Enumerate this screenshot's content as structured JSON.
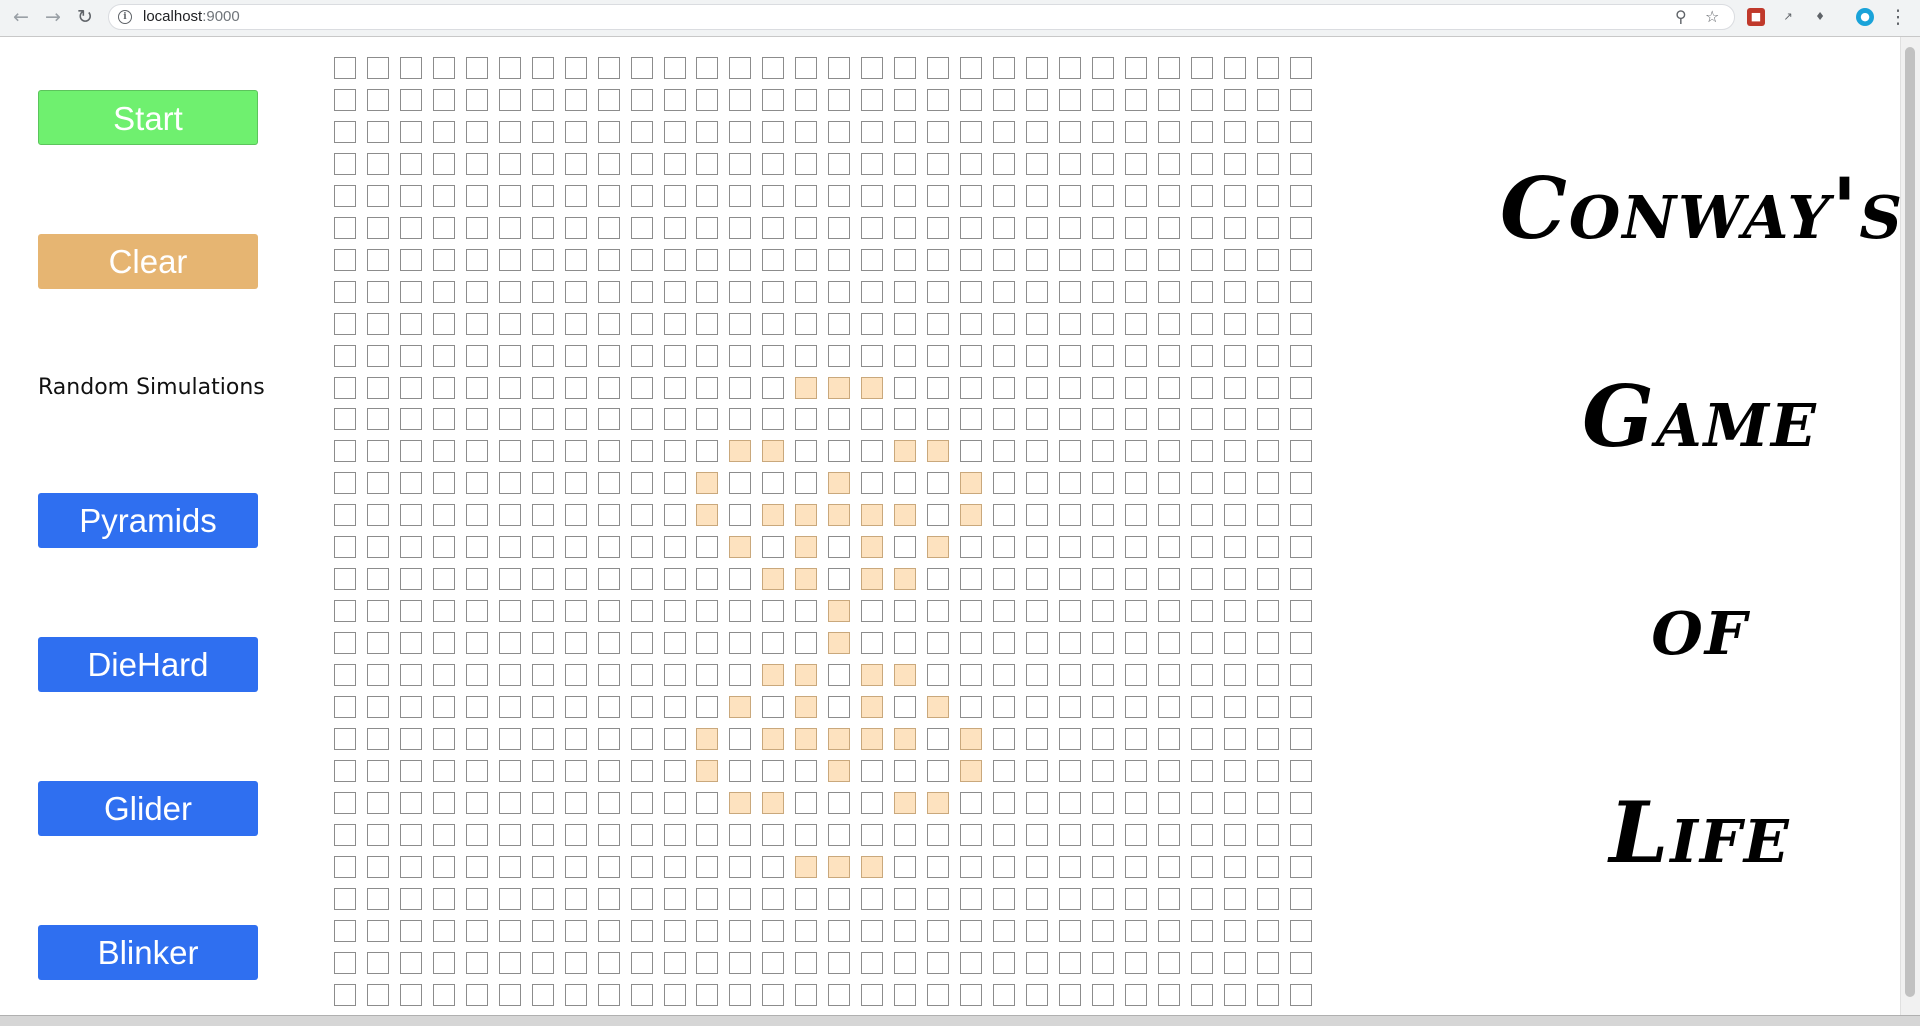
{
  "browser": {
    "url_host": "localhost",
    "url_port": ":9000",
    "back_icon": "arrow-left-icon",
    "forward_icon": "arrow-right-icon",
    "reload_icon": "reload-icon"
  },
  "sidebar": {
    "start_label": "Start",
    "clear_label": "Clear",
    "random_label": "Random Simulations",
    "presets": [
      {
        "label": "Pyramids"
      },
      {
        "label": "DieHard"
      },
      {
        "label": "Glider"
      },
      {
        "label": "Blinker"
      }
    ],
    "colors": {
      "start": "#6ff06f",
      "clear": "#e6b572",
      "preset": "#2f6ff0"
    }
  },
  "title": {
    "line1": "Conway's",
    "line2": "Game",
    "line3": "of",
    "line4": "Life"
  },
  "grid": {
    "rows": 30,
    "cols": 30,
    "alive_color": "#fde2bf",
    "alive_cells": [
      [
        10,
        14
      ],
      [
        10,
        15
      ],
      [
        10,
        16
      ],
      [
        12,
        12
      ],
      [
        12,
        13
      ],
      [
        12,
        17
      ],
      [
        12,
        18
      ],
      [
        13,
        11
      ],
      [
        13,
        15
      ],
      [
        13,
        19
      ],
      [
        14,
        11
      ],
      [
        14,
        13
      ],
      [
        14,
        14
      ],
      [
        14,
        15
      ],
      [
        14,
        16
      ],
      [
        14,
        17
      ],
      [
        14,
        19
      ],
      [
        15,
        12
      ],
      [
        15,
        14
      ],
      [
        15,
        16
      ],
      [
        15,
        18
      ],
      [
        16,
        13
      ],
      [
        16,
        14
      ],
      [
        16,
        16
      ],
      [
        16,
        17
      ],
      [
        17,
        15
      ],
      [
        18,
        15
      ],
      [
        19,
        13
      ],
      [
        19,
        14
      ],
      [
        19,
        16
      ],
      [
        19,
        17
      ],
      [
        20,
        12
      ],
      [
        20,
        14
      ],
      [
        20,
        16
      ],
      [
        20,
        18
      ],
      [
        21,
        11
      ],
      [
        21,
        13
      ],
      [
        21,
        14
      ],
      [
        21,
        15
      ],
      [
        21,
        16
      ],
      [
        21,
        17
      ],
      [
        21,
        19
      ],
      [
        22,
        11
      ],
      [
        22,
        15
      ],
      [
        22,
        19
      ],
      [
        23,
        12
      ],
      [
        23,
        13
      ],
      [
        23,
        17
      ],
      [
        23,
        18
      ],
      [
        25,
        14
      ],
      [
        25,
        15
      ],
      [
        25,
        16
      ]
    ]
  }
}
